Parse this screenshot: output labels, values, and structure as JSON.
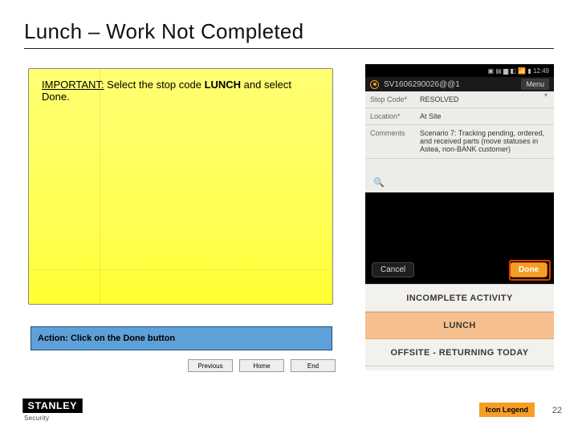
{
  "title": "Lunch – Work Not Completed",
  "callout": {
    "label": "IMPORTANT:",
    "text_before": " Select the stop code ",
    "bold": "LUNCH",
    "text_after": " and select Done."
  },
  "action": "Action:  Click on the Done button",
  "nav": {
    "previous": "Previous",
    "home": "Home",
    "end": "End"
  },
  "logo": {
    "line1": "STANLEY",
    "line2": "Security"
  },
  "icon_legend": "Icon Legend",
  "page_number": "22",
  "phone": {
    "statusbar": {
      "icons": "▣ ▤ ▆ ◧ 📶 ▮ 12:49"
    },
    "banner": {
      "title": "SV1606290026@@1",
      "menu": "Menu"
    },
    "form": {
      "stop_code_label": "Stop Code*",
      "stop_code_value": "RESOLVED",
      "location_label": "Location*",
      "location_value": "At Site",
      "comments_label": "Comments",
      "comments_value": "Scenario 7: Tracking pending, ordered, and received parts (move statuses in Astea, non-BANK customer)"
    },
    "buttons": {
      "cancel": "Cancel",
      "done": "Done"
    },
    "options": {
      "incomplete": "INCOMPLETE ACTIVITY",
      "lunch": "LUNCH",
      "offsite": "OFFSITE - RETURNING TODAY"
    }
  }
}
